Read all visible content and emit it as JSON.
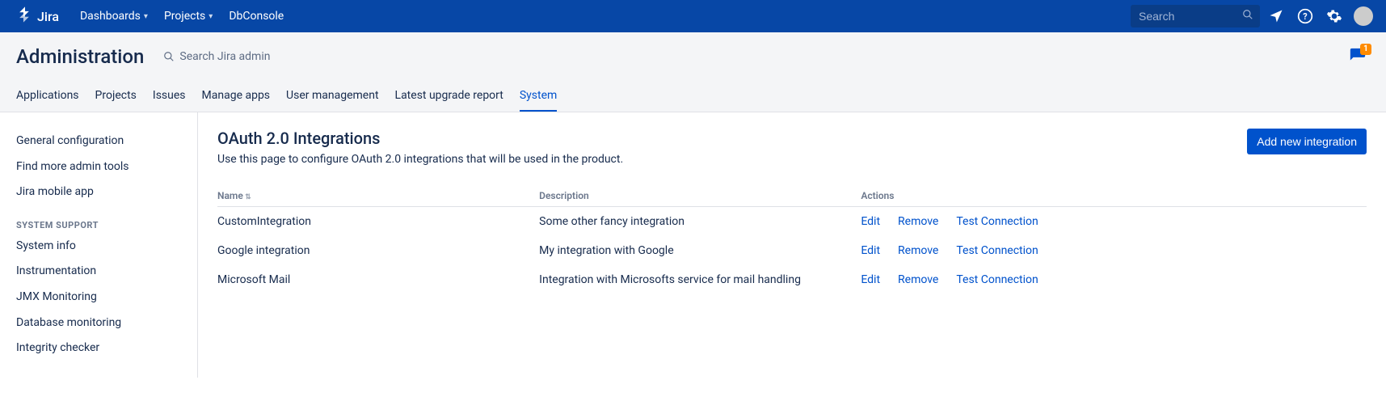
{
  "navbar": {
    "logo_text": "Jira",
    "items": [
      {
        "label": "Dashboards",
        "has_chevron": true
      },
      {
        "label": "Projects",
        "has_chevron": true
      },
      {
        "label": "DbConsole",
        "has_chevron": false
      }
    ],
    "search_placeholder": "Search"
  },
  "admin_header": {
    "title": "Administration",
    "search_label": "Search Jira admin",
    "feedback_badge": "1"
  },
  "tabs": [
    {
      "label": "Applications",
      "active": false
    },
    {
      "label": "Projects",
      "active": false
    },
    {
      "label": "Issues",
      "active": false
    },
    {
      "label": "Manage apps",
      "active": false
    },
    {
      "label": "User management",
      "active": false
    },
    {
      "label": "Latest upgrade report",
      "active": false
    },
    {
      "label": "System",
      "active": true
    }
  ],
  "sidebar": {
    "top_items": [
      "General configuration",
      "Find more admin tools",
      "Jira mobile app"
    ],
    "group_header": "SYSTEM SUPPORT",
    "group_items": [
      "System info",
      "Instrumentation",
      "JMX Monitoring",
      "Database monitoring",
      "Integrity checker"
    ]
  },
  "content": {
    "title": "OAuth 2.0 Integrations",
    "description": "Use this page to configure OAuth 2.0 integrations that will be used in the product.",
    "add_button": "Add new integration",
    "columns": {
      "name": "Name",
      "description": "Description",
      "actions": "Actions"
    },
    "action_labels": {
      "edit": "Edit",
      "remove": "Remove",
      "test": "Test Connection"
    },
    "rows": [
      {
        "name": "CustomIntegration",
        "description": "Some other fancy integration"
      },
      {
        "name": "Google integration",
        "description": "My integration with Google"
      },
      {
        "name": "Microsoft Mail",
        "description": "Integration with Microsofts service for mail handling"
      }
    ]
  }
}
